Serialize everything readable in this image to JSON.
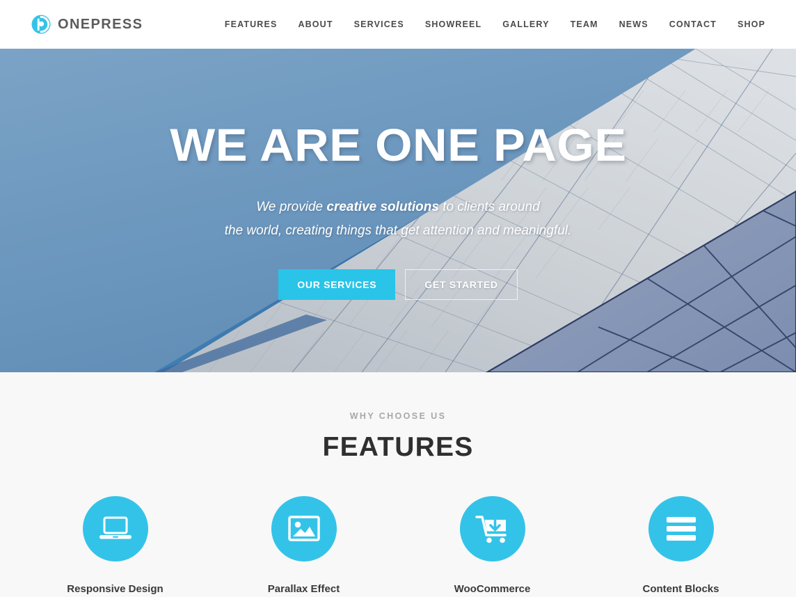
{
  "header": {
    "logo": {
      "icon": "onepress-circle-p-icon",
      "text": "ONEPRESS",
      "color": "#34c3e8"
    },
    "nav": [
      {
        "label": "FEATURES"
      },
      {
        "label": "ABOUT"
      },
      {
        "label": "SERVICES"
      },
      {
        "label": "SHOWREEL"
      },
      {
        "label": "GALLERY"
      },
      {
        "label": "TEAM"
      },
      {
        "label": "NEWS"
      },
      {
        "label": "CONTACT"
      },
      {
        "label": "SHOP"
      }
    ]
  },
  "hero": {
    "title": "WE ARE ONE PAGE",
    "subtitle_line1_pre": "We provide ",
    "subtitle_emphasis": "creative solutions",
    "subtitle_line1_post": " to clients around",
    "subtitle_line2": "the world, creating things that get attention and meaningful.",
    "primary_button": "OUR SERVICES",
    "secondary_button": "GET STARTED",
    "background_description": "architectural roof photo, blue sky upper-left, gray tiled diagonal facade, dark blue faceted panel lower-right",
    "colors": {
      "sky": "#6b97bd",
      "facade": "#c9ced4",
      "panel": "#8a9bb8",
      "seam": "#3c4f7e",
      "accent": "#29c4e8"
    }
  },
  "features": {
    "eyebrow": "WHY CHOOSE US",
    "title": "FEATURES",
    "accent_color": "#34c3e8",
    "items": [
      {
        "label": "Responsive Design",
        "icon": "laptop-icon"
      },
      {
        "label": "Parallax Effect",
        "icon": "image-icon"
      },
      {
        "label": "WooCommerce",
        "icon": "shopping-cart-download-icon"
      },
      {
        "label": "Content Blocks",
        "icon": "content-blocks-icon"
      }
    ]
  }
}
